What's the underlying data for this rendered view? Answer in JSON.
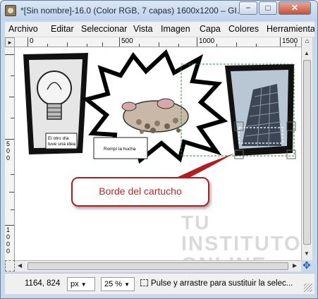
{
  "window": {
    "title": "*[Sin nombre]-16.0 (Color RGB, 7 capas) 1600x1200 – GI...",
    "minimize_glyph": "−",
    "maximize_glyph": "□",
    "close_glyph": "✕"
  },
  "menubar": {
    "items": [
      "Archivo",
      "Editar",
      "Seleccionar",
      "Vista",
      "Imagen",
      "Capa",
      "Colores",
      "Herramientas"
    ]
  },
  "ruler": {
    "h_labels": [
      "0",
      "500",
      "1000",
      "1500"
    ],
    "v_labels": [
      "5",
      "0",
      "0",
      "1",
      "0",
      "0",
      "0"
    ]
  },
  "canvas": {
    "panel1_caption": "El otro día tuve una idea",
    "panel2_caption": "Rompí la hucha",
    "callout_text": "Borde del cartucho"
  },
  "watermark": {
    "line1": "TU",
    "line2": "INSTITUTO",
    "line3": "ONLINE"
  },
  "statusbar": {
    "coords": "1164, 824",
    "unit": "px",
    "zoom": "25 %",
    "message": "Pulse y arrastre para sustituir la selec..."
  },
  "colors": {
    "callout_border": "#b01e23",
    "callout_text": "#c0281f",
    "selection_guide": "#2e8b2e"
  }
}
